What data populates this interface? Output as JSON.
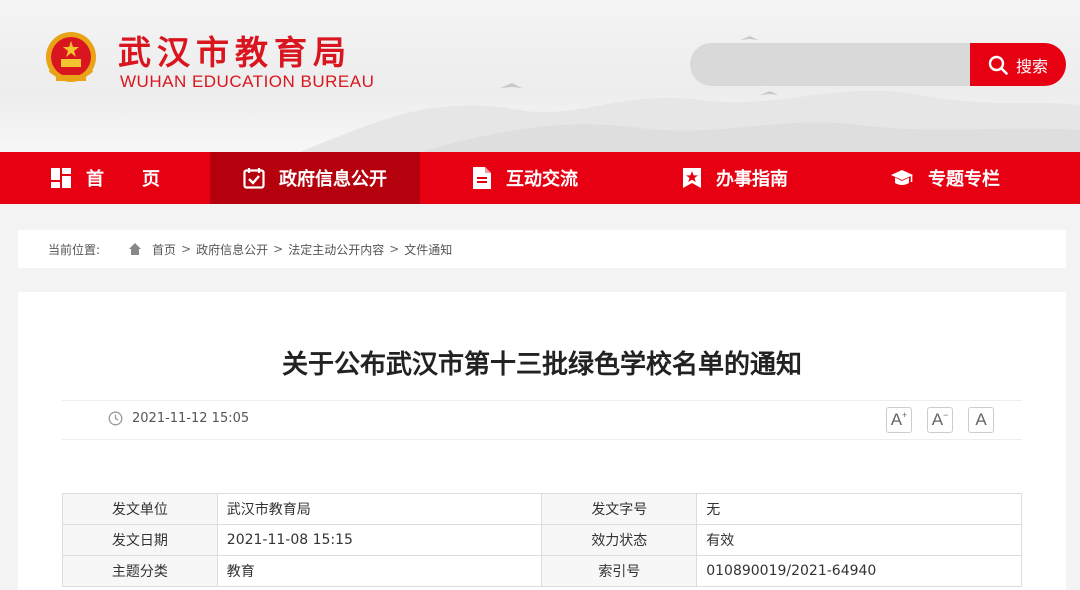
{
  "site": {
    "title_cn": "武汉市教育局",
    "title_en": "WUHAN EDUCATION BUREAU"
  },
  "search": {
    "placeholder": "",
    "button_label": "搜索"
  },
  "nav": {
    "items": [
      {
        "label": "首页",
        "icon": "home-grid-icon"
      },
      {
        "label": "政府信息公开",
        "icon": "calendar-check-icon"
      },
      {
        "label": "互动交流",
        "icon": "document-icon"
      },
      {
        "label": "办事指南",
        "icon": "bookmark-star-icon"
      },
      {
        "label": "专题专栏",
        "icon": "graduation-cap-icon"
      }
    ],
    "active_index": 1
  },
  "breadcrumb": {
    "label": "当前位置:",
    "items": [
      "首页",
      "政府信息公开",
      "法定主动公开内容",
      "文件通知"
    ],
    "separator": ">"
  },
  "article": {
    "title": "关于公布武汉市第十三批绿色学校名单的通知",
    "publish_time": "2021-11-12 15:05",
    "font_controls": [
      "A",
      "A",
      "A"
    ]
  },
  "info_table": {
    "rows": [
      {
        "k1": "发文单位",
        "v1": "武汉市教育局",
        "k2": "发文字号",
        "v2": "无"
      },
      {
        "k1": "发文日期",
        "v1": "2021-11-08 15:15",
        "k2": "效力状态",
        "v2": "有效"
      },
      {
        "k1": "主题分类",
        "v1": "教育",
        "k2": "索引号",
        "v2": "010890019/2021-64940"
      }
    ]
  },
  "colors": {
    "brand_red": "#e60012",
    "nav_active": "#b5000d"
  }
}
